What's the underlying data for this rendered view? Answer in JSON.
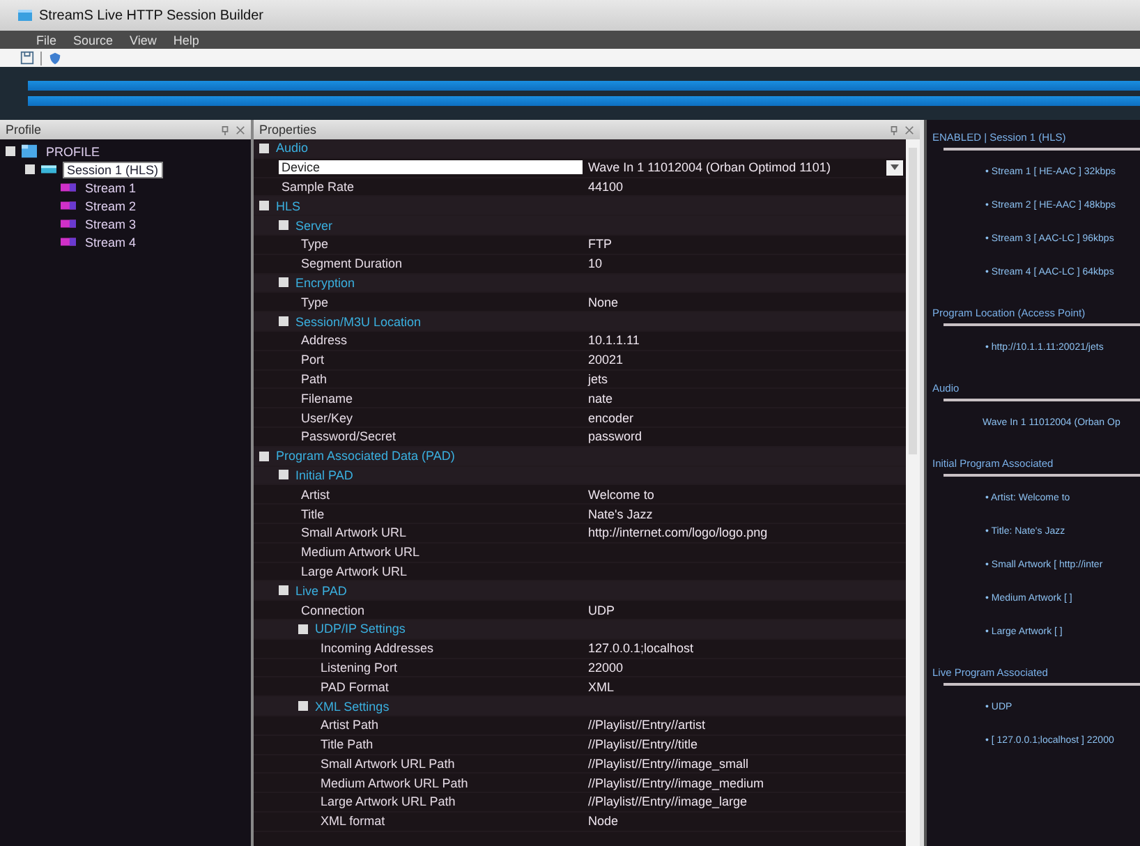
{
  "window": {
    "title": "StreamS Live HTTP Session Builder"
  },
  "menu": [
    "File",
    "Source",
    "View",
    "Help"
  ],
  "profile_panel": {
    "title": "Profile",
    "tree": [
      {
        "label": "PROFILE",
        "kind": "profile",
        "selected": false,
        "children": [
          {
            "label": "Session 1 (HLS)",
            "kind": "session",
            "selected": true,
            "children": [
              {
                "label": "Stream 1",
                "kind": "stream",
                "selected": false
              },
              {
                "label": "Stream 2",
                "kind": "stream",
                "selected": false
              },
              {
                "label": "Stream 3",
                "kind": "stream",
                "selected": false
              },
              {
                "label": "Stream 4",
                "kind": "stream",
                "selected": false
              }
            ]
          }
        ]
      }
    ]
  },
  "properties_panel": {
    "title": "Properties",
    "items": [
      {
        "kind": "category",
        "label": "Audio",
        "children": [
          {
            "kind": "property",
            "name": "Device",
            "value": "Wave In 1 11012004 (Orban Optimod 1101)",
            "selected": true,
            "dropdown": true
          },
          {
            "kind": "property",
            "name": "Sample Rate",
            "value": "44100",
            "selected": false
          }
        ]
      },
      {
        "kind": "category",
        "label": "HLS",
        "children": [
          {
            "kind": "category",
            "label": "Server",
            "children": [
              {
                "kind": "property",
                "name": "Type",
                "value": "FTP",
                "selected": false
              },
              {
                "kind": "property",
                "name": "Segment Duration",
                "value": "10",
                "selected": false
              }
            ]
          },
          {
            "kind": "category",
            "label": "Encryption",
            "children": [
              {
                "kind": "property",
                "name": "Type",
                "value": "None",
                "selected": false
              }
            ]
          },
          {
            "kind": "category",
            "label": "Session/M3U Location",
            "children": [
              {
                "kind": "property",
                "name": "Address",
                "value": "10.1.1.11",
                "selected": false
              },
              {
                "kind": "property",
                "name": "Port",
                "value": "20021",
                "selected": false
              },
              {
                "kind": "property",
                "name": "Path",
                "value": "jets",
                "selected": false
              },
              {
                "kind": "property",
                "name": "Filename",
                "value": "nate",
                "selected": false
              },
              {
                "kind": "property",
                "name": "User/Key",
                "value": "encoder",
                "selected": false
              },
              {
                "kind": "property",
                "name": "Password/Secret",
                "value": "password",
                "selected": false
              }
            ]
          }
        ]
      },
      {
        "kind": "category",
        "label": "Program Associated Data (PAD)",
        "children": [
          {
            "kind": "category",
            "label": "Initial PAD",
            "children": [
              {
                "kind": "property",
                "name": "Artist",
                "value": "Welcome to",
                "selected": false
              },
              {
                "kind": "property",
                "name": "Title",
                "value": "Nate's Jazz",
                "selected": false
              },
              {
                "kind": "property",
                "name": "Small Artwork URL",
                "value": "http://internet.com/logo/logo.png",
                "selected": false
              },
              {
                "kind": "property",
                "name": "Medium Artwork URL",
                "selected": false
              },
              {
                "kind": "property",
                "name": "Large Artwork URL",
                "selected": false
              }
            ]
          },
          {
            "kind": "category",
            "label": "Live PAD",
            "children": [
              {
                "kind": "property",
                "name": "Connection",
                "value": "UDP",
                "selected": false
              },
              {
                "kind": "category",
                "label": "UDP/IP Settings",
                "children": [
                  {
                    "kind": "property",
                    "name": "Incoming Addresses",
                    "value": "127.0.0.1;localhost",
                    "selected": false
                  },
                  {
                    "kind": "property",
                    "name": "Listening Port",
                    "value": "22000",
                    "selected": false
                  },
                  {
                    "kind": "property",
                    "name": "PAD Format",
                    "value": "XML",
                    "selected": false
                  }
                ]
              },
              {
                "kind": "category",
                "label": "XML Settings",
                "children": [
                  {
                    "kind": "property",
                    "name": "Artist Path",
                    "value": "//Playlist//Entry//artist",
                    "selected": false
                  },
                  {
                    "kind": "property",
                    "name": "Title Path",
                    "value": "//Playlist//Entry//title",
                    "selected": false
                  },
                  {
                    "kind": "property",
                    "name": "Small Artwork URL Path",
                    "value": "//Playlist//Entry//image_small",
                    "selected": false
                  },
                  {
                    "kind": "property",
                    "name": "Medium Artwork URL Path",
                    "value": "//Playlist//Entry//image_medium",
                    "selected": false
                  },
                  {
                    "kind": "property",
                    "name": "Large Artwork URL Path",
                    "value": "//Playlist//Entry//image_large",
                    "selected": false
                  },
                  {
                    "kind": "property",
                    "name": "XML format",
                    "value": "Node",
                    "selected": false
                  }
                ]
              }
            ]
          }
        ]
      }
    ]
  },
  "summary_panel": {
    "sections": [
      {
        "heading": "ENABLED | Session 1 (HLS)",
        "lines": [
          "• Stream 1 [ HE-AAC ] 32kbps",
          "• Stream 2 [ HE-AAC ] 48kbps",
          "• Stream 3 [ AAC-LC ] 96kbps",
          "• Stream 4 [ AAC-LC ] 64kbps"
        ]
      },
      {
        "heading": "Program Location (Access Point)",
        "lines": [
          "• http://10.1.1.11:20021/jets"
        ]
      },
      {
        "heading": "Audio",
        "lines": [
          "Wave In 1 11012004 (Orban Op"
        ]
      },
      {
        "heading": "Initial Program Associated",
        "lines": [
          "• Artist: Welcome to",
          "• Title: Nate's Jazz",
          "• Small Artwork [ http://inter",
          "• Medium Artwork [ ]",
          "• Large Artwork [ ]"
        ]
      },
      {
        "heading": "Live Program Associated",
        "lines": [
          "• UDP",
          "• [ 127.0.0.1;localhost ] 22000"
        ]
      }
    ]
  }
}
